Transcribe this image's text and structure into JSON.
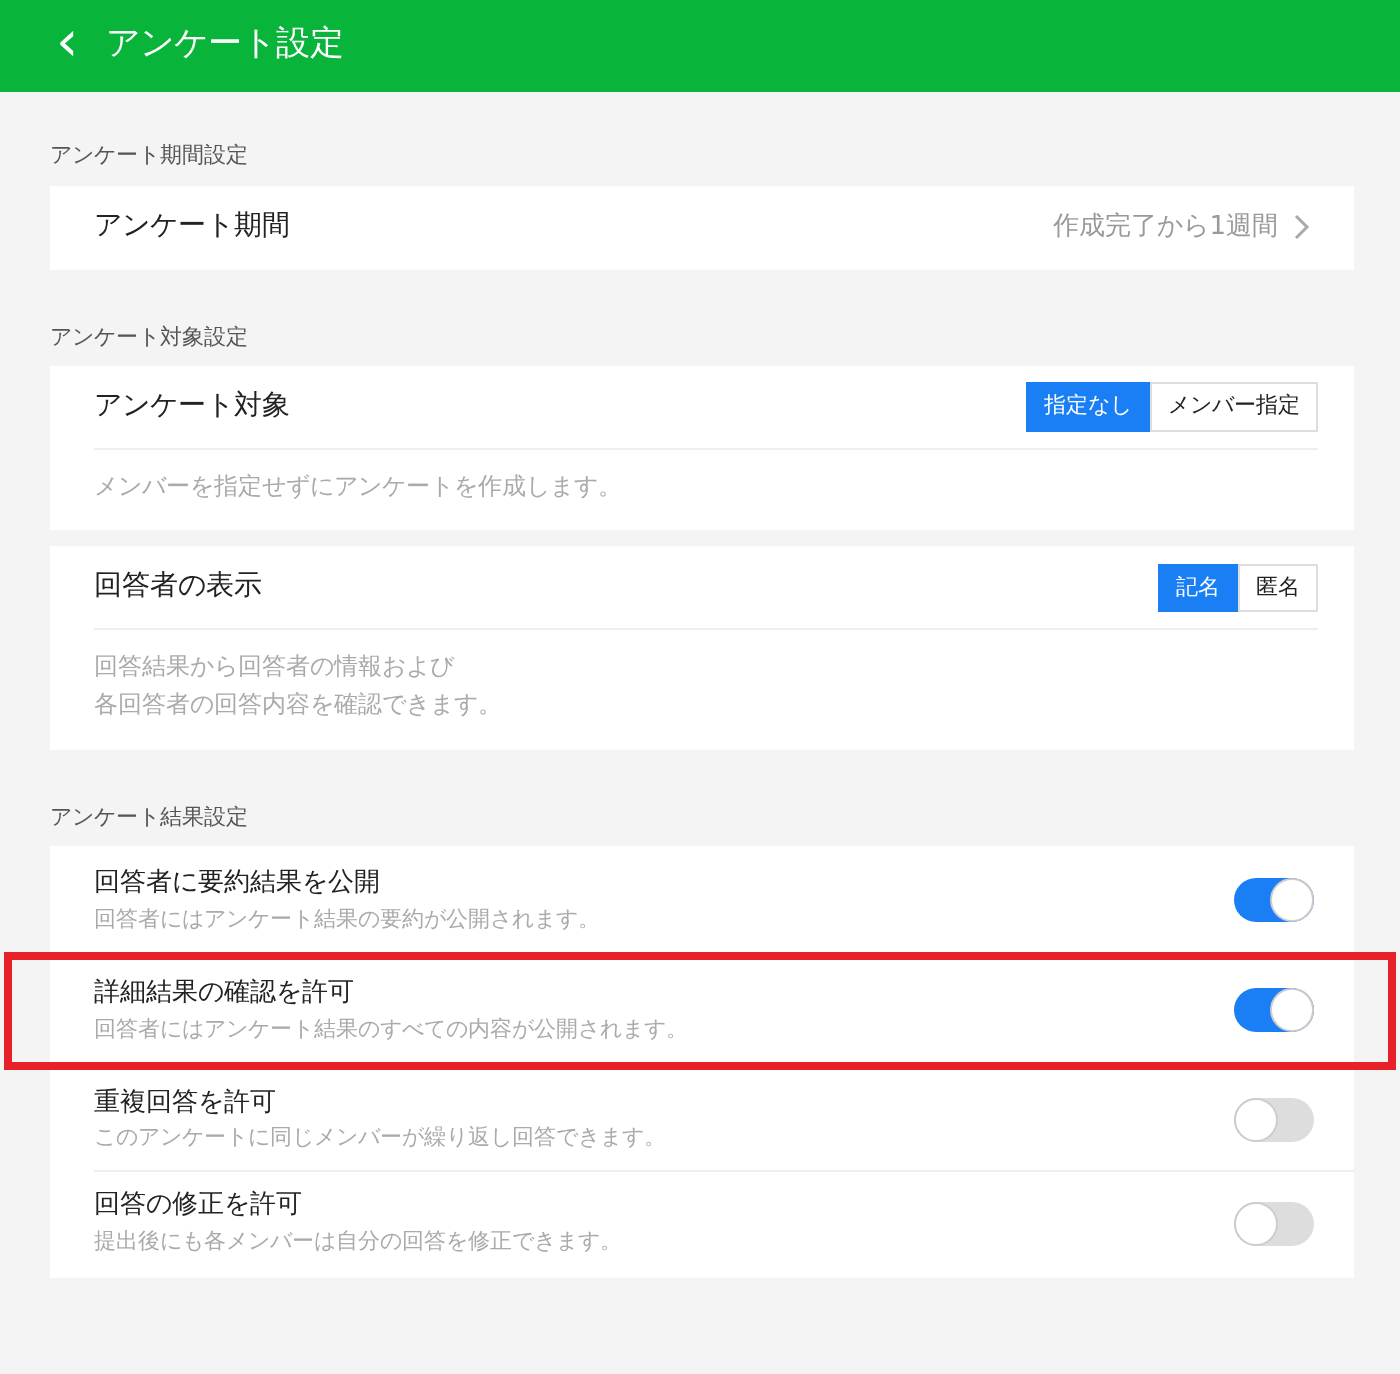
{
  "header": {
    "back_icon": "‹",
    "title": "アンケート設定"
  },
  "sections": [
    {
      "label": "アンケート期間設定",
      "cards": [
        {
          "kind": "link",
          "title": "アンケート期間",
          "value": "作成完了から1週間"
        }
      ]
    },
    {
      "label": "アンケート対象設定",
      "cards": [
        {
          "kind": "segmented",
          "title": "アンケート対象",
          "options": [
            {
              "label": "指定なし",
              "selected": true
            },
            {
              "label": "メンバー指定",
              "selected": false
            }
          ],
          "description": [
            "メンバーを指定せずにアンケートを作成します。"
          ]
        },
        {
          "kind": "segmented",
          "title": "回答者の表示",
          "options": [
            {
              "label": "記名",
              "selected": true
            },
            {
              "label": "匿名",
              "selected": false
            }
          ],
          "description": [
            "回答結果から回答者の情報および",
            "各回答者の回答内容を確認できます。"
          ]
        }
      ]
    },
    {
      "label": "アンケート結果設定",
      "cards": [
        {
          "kind": "toggles",
          "items": [
            {
              "title": "回答者に要約結果を公開",
              "description": "回答者にはアンケート結果の要約が公開されます。",
              "on": true,
              "highlighted": false
            },
            {
              "title": "詳細結果の確認を許可",
              "description": "回答者にはアンケート結果のすべての内容が公開されます。",
              "on": true,
              "highlighted": true
            },
            {
              "title": "重複回答を許可",
              "description": "このアンケートに同じメンバーが繰り返し回答できます。",
              "on": false,
              "highlighted": false
            },
            {
              "title": "回答の修正を許可",
              "description": "提出後にも各メンバーは自分の回答を修正できます。",
              "on": false,
              "highlighted": false
            }
          ]
        }
      ]
    }
  ]
}
